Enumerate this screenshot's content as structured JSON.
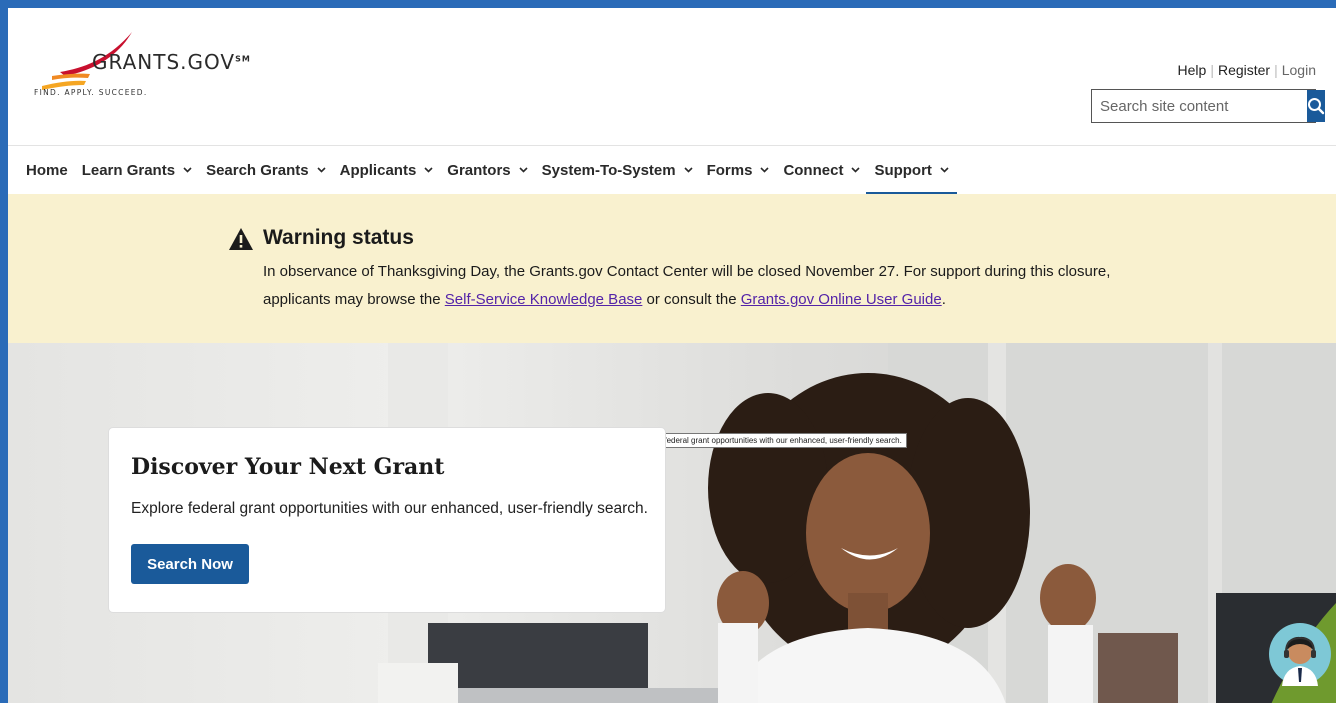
{
  "header": {
    "logo_text": "GRANTS.GOV",
    "logo_mark": "SM",
    "tagline": "FIND. APPLY. SUCCEED.",
    "util_links": {
      "help": "Help",
      "register": "Register",
      "login": "Login"
    },
    "search": {
      "placeholder": "Search site content",
      "value": ""
    }
  },
  "nav": {
    "items": [
      {
        "label": "Home",
        "has_dropdown": false
      },
      {
        "label": "Learn Grants",
        "has_dropdown": true
      },
      {
        "label": "Search Grants",
        "has_dropdown": true
      },
      {
        "label": "Applicants",
        "has_dropdown": true
      },
      {
        "label": "Grantors",
        "has_dropdown": true
      },
      {
        "label": "System-To-System",
        "has_dropdown": true
      },
      {
        "label": "Forms",
        "has_dropdown": true
      },
      {
        "label": "Connect",
        "has_dropdown": true
      },
      {
        "label": "Support",
        "has_dropdown": true,
        "active": true
      }
    ]
  },
  "alert": {
    "title": "Warning status",
    "text_1": "In observance of Thanksgiving Day, the Grants.gov Contact Center will be closed November 27. For support during this closure, applicants may browse the ",
    "link_1": "Self-Service Knowledge Base",
    "text_2": " or consult the ",
    "link_2": "Grants.gov Online User Guide",
    "text_3": "."
  },
  "hero": {
    "title": "Discover Your Next Grant",
    "description": "Explore federal grant opportunities with our enhanced, user-friendly search.",
    "button_label": "Search Now",
    "tooltip": "Explore federal grant opportunities with our enhanced, user-friendly search."
  },
  "colors": {
    "primary": "#1a5a9a",
    "alert_bg": "#f9f1cf",
    "link_visited": "#5424a8",
    "logo_red": "#c8102e",
    "logo_orange": "#f08a24",
    "page_frame": "#2a6bb8"
  }
}
